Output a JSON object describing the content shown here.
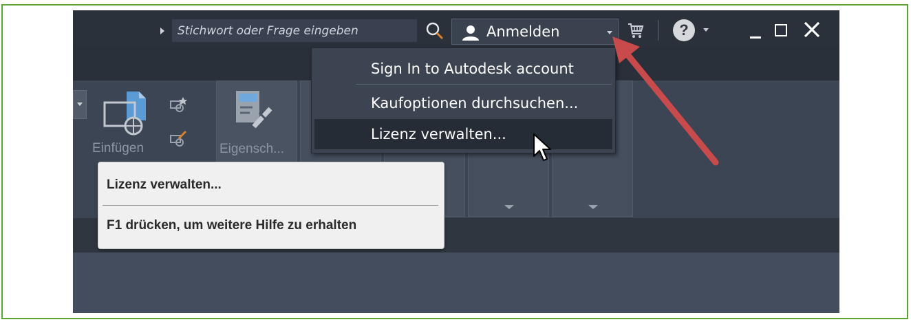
{
  "search": {
    "placeholder": "Stichwort oder Frage eingeben"
  },
  "header": {
    "signin_label": "Anmelden"
  },
  "help": {
    "glyph": "?"
  },
  "menu": {
    "items": [
      {
        "label": "Sign In to Autodesk account"
      },
      {
        "label": "Kaufoptionen durchsuchen..."
      },
      {
        "label": "Lizenz verwalten..."
      }
    ],
    "highlighted_index": 2
  },
  "ribbon": {
    "insert_label": "Einfügen",
    "properties_label": "Eigensch..."
  },
  "tooltip": {
    "title": "Lizenz verwalten...",
    "hint": "F1 drücken, um weitere Hilfe zu erhalten"
  },
  "colors": {
    "frame_border": "#5aa532",
    "titlebar": "#2b313b",
    "ribbon": "#3c4554",
    "menu_bg": "#3c4451",
    "menu_highlight": "#262c35",
    "tooltip_bg": "#f0f0f0",
    "annotation_arrow": "#c94a4a"
  },
  "icons": [
    "play-icon",
    "search-icon",
    "user-icon",
    "cart-icon",
    "help-icon",
    "minimize-icon",
    "maximize-icon",
    "close-icon",
    "cursor-icon"
  ]
}
